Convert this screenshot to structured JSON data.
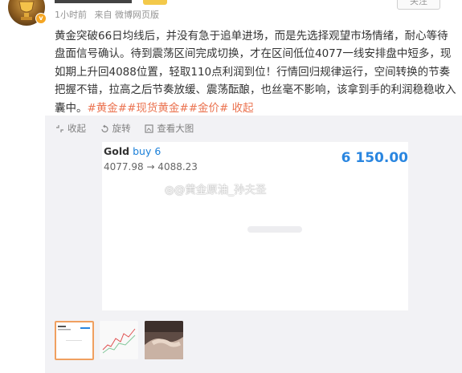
{
  "user": {
    "time": "1小时前",
    "source": "来自 微博网页版",
    "follow_label": "关注"
  },
  "post": {
    "text": "黄金突破66日均线后，并没有急于追单进场，而是先选择观望市场情绪，耐心等待盘面信号确认。待到震荡区间完成切换，才在区间低位4077一线安排盘中短多，现如期上升回4088位置，轻取110点利润到位！行情回归规律运行，空间转换的节奏把握不错，拉高之后节奏放缓、震荡酝酿，也丝毫不影响，该拿到手的利润稳稳收入囊中。",
    "tags": "#黄金##现货黄金##金价#",
    "collapse_label": "收起"
  },
  "toolbar": {
    "collapse": "收起",
    "rotate": "旋转",
    "view_large": "查看大图"
  },
  "trade_card": {
    "symbol": "Gold",
    "action": "buy 6",
    "prices": "4077.98 → 4088.23",
    "profit": "6 150.00"
  },
  "watermark": "@黄金原油_孙夫圣",
  "thumbnails": [
    {
      "name": "trade-screenshot"
    },
    {
      "name": "price-chart"
    },
    {
      "name": "handshake-photo"
    }
  ],
  "colors": {
    "tag": "#eb7350",
    "profit": "#2a86e0",
    "buy": "#1a7fd8",
    "panel": "#f2f2f5"
  }
}
